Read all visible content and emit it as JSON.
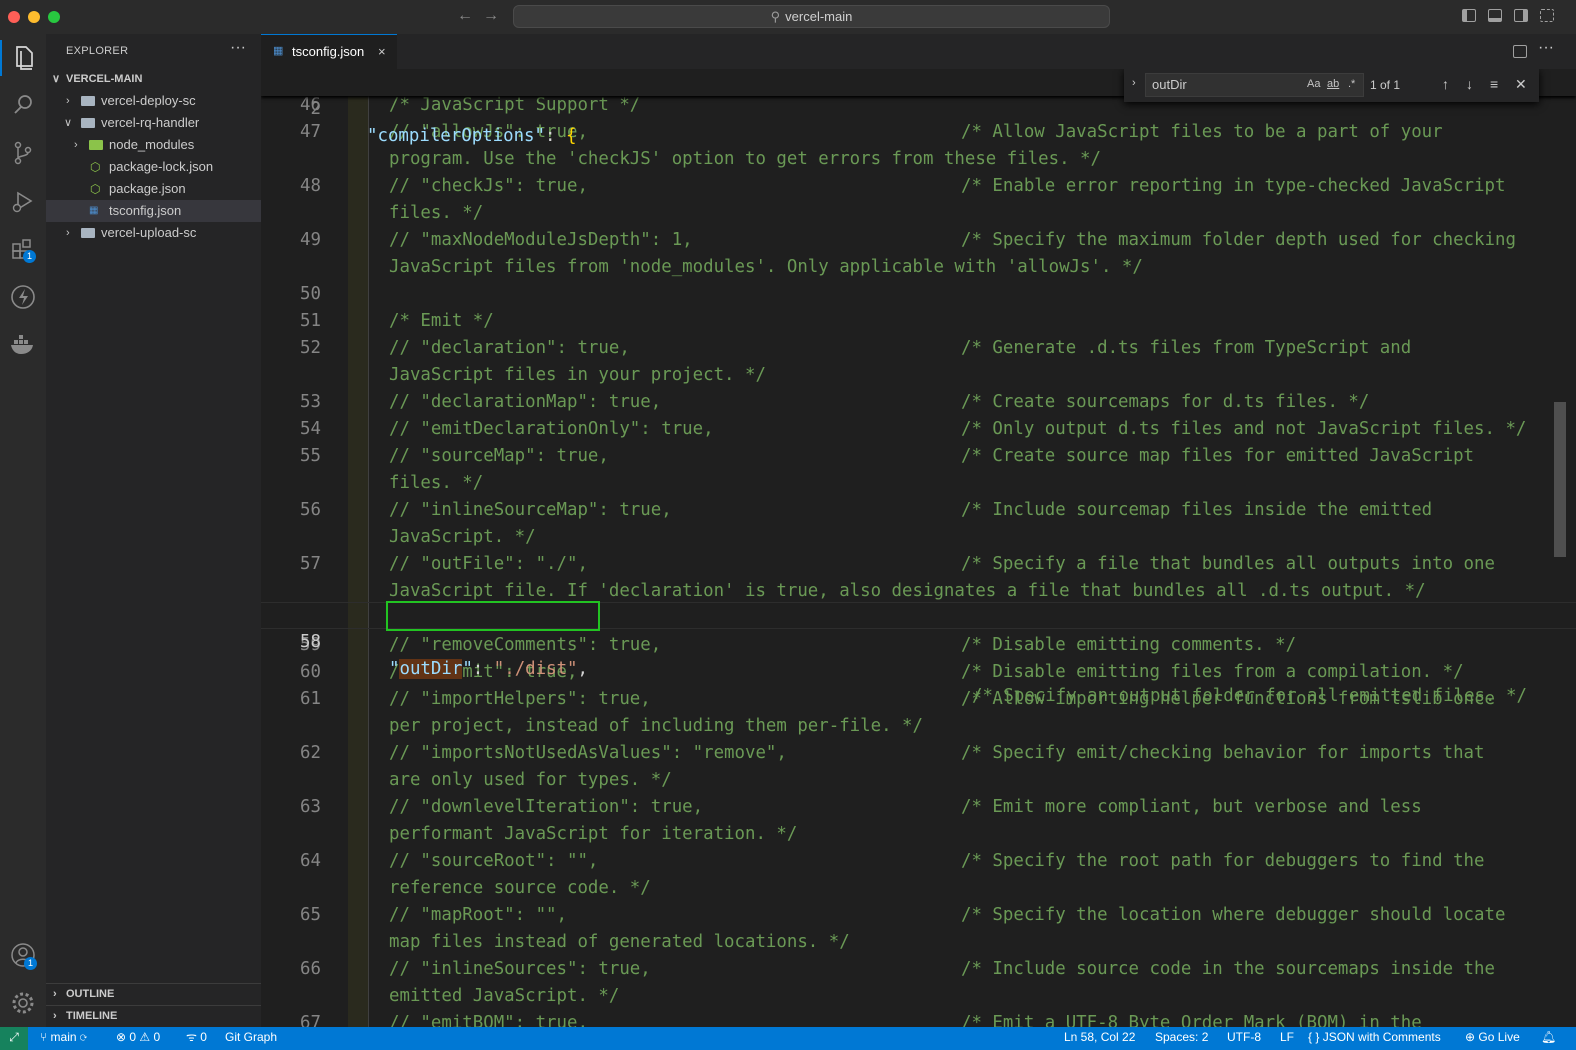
{
  "window": {
    "title": "vercel-main"
  },
  "explorer": {
    "title": "EXPLORER",
    "more": "···",
    "repo": "VERCEL-MAIN",
    "items": [
      {
        "label": "vercel-deploy-sc"
      },
      {
        "label": "vercel-rq-handler"
      },
      {
        "label": "node_modules"
      },
      {
        "label": "package-lock.json"
      },
      {
        "label": "package.json"
      },
      {
        "label": "tsconfig.json"
      },
      {
        "label": "vercel-upload-sc"
      }
    ],
    "outline": "OUTLINE",
    "timeline": "TIMELINE"
  },
  "activity": {
    "extensions_badge": "1",
    "accounts_badge": "1"
  },
  "tab": {
    "label": "tsconfig.json",
    "close": "×"
  },
  "find": {
    "value": "outDir",
    "count": "1 of 1",
    "opt_case": "Aa",
    "opt_word": "ab",
    "opt_regex": ".*"
  },
  "editor": {
    "sticky": {
      "num": "2",
      "key": "\"compilerOptions\"",
      "colon": ": ",
      "brace": "{"
    },
    "rows": [
      {
        "num": "46",
        "code": "/* JavaScript Support */",
        "comment": ""
      },
      {
        "num": "47",
        "code": "// \"allowJs\": true,",
        "comment": "/* Allow JavaScript files to be a part of your"
      },
      {
        "num": "",
        "code": "program. Use the 'checkJS' option to get errors from these files. */",
        "comment": ""
      },
      {
        "num": "48",
        "code": "// \"checkJs\": true,",
        "comment": "/* Enable error reporting in type-checked JavaScript"
      },
      {
        "num": "",
        "code": "files. */",
        "comment": ""
      },
      {
        "num": "49",
        "code": "// \"maxNodeModuleJsDepth\": 1,",
        "comment": "/* Specify the maximum folder depth used for checking"
      },
      {
        "num": "",
        "code": "JavaScript files from 'node_modules'. Only applicable with 'allowJs'. */",
        "comment": ""
      },
      {
        "num": "50",
        "code": "",
        "comment": ""
      },
      {
        "num": "51",
        "code": "/* Emit */",
        "comment": ""
      },
      {
        "num": "52",
        "code": "// \"declaration\": true,",
        "comment": "/* Generate .d.ts files from TypeScript and"
      },
      {
        "num": "",
        "code": "JavaScript files in your project. */",
        "comment": ""
      },
      {
        "num": "53",
        "code": "// \"declarationMap\": true,",
        "comment": "/* Create sourcemaps for d.ts files. */"
      },
      {
        "num": "54",
        "code": "// \"emitDeclarationOnly\": true,",
        "comment": "/* Only output d.ts files and not JavaScript files. */"
      },
      {
        "num": "55",
        "code": "// \"sourceMap\": true,",
        "comment": "/* Create source map files for emitted JavaScript"
      },
      {
        "num": "",
        "code": "files. */",
        "comment": ""
      },
      {
        "num": "56",
        "code": "// \"inlineSourceMap\": true,",
        "comment": "/* Include sourcemap files inside the emitted"
      },
      {
        "num": "",
        "code": "JavaScript. */",
        "comment": ""
      },
      {
        "num": "57",
        "code": "// \"outFile\": \"./\",",
        "comment": "/* Specify a file that bundles all outputs into one"
      },
      {
        "num": "",
        "code": "JavaScript file. If 'declaration' is true, also designates a file that bundles all .d.ts output. */",
        "comment": ""
      },
      {
        "num": "58",
        "code": "",
        "comment": ""
      },
      {
        "num": "59",
        "code": "// \"removeComments\": true,",
        "comment": "/* Disable emitting comments. */"
      },
      {
        "num": "60",
        "code": "// \"noEmit\": true,",
        "comment": "/* Disable emitting files from a compilation. */"
      },
      {
        "num": "61",
        "code": "// \"importHelpers\": true,",
        "comment": "/* Allow importing helper functions from tslib once"
      },
      {
        "num": "",
        "code": "per project, instead of including them per-file. */",
        "comment": ""
      },
      {
        "num": "62",
        "code": "// \"importsNotUsedAsValues\": \"remove\",",
        "comment": "/* Specify emit/checking behavior for imports that"
      },
      {
        "num": "",
        "code": "are only used for types. */",
        "comment": ""
      },
      {
        "num": "63",
        "code": "// \"downlevelIteration\": true,",
        "comment": "/* Emit more compliant, but verbose and less"
      },
      {
        "num": "",
        "code": "performant JavaScript for iteration. */",
        "comment": ""
      },
      {
        "num": "64",
        "code": "// \"sourceRoot\": \"\",",
        "comment": "/* Specify the root path for debuggers to find the"
      },
      {
        "num": "",
        "code": "reference source code. */",
        "comment": ""
      },
      {
        "num": "65",
        "code": "// \"mapRoot\": \"\",",
        "comment": "/* Specify the location where debugger should locate"
      },
      {
        "num": "",
        "code": "map files instead of generated locations. */",
        "comment": ""
      },
      {
        "num": "66",
        "code": "// \"inlineSources\": true,",
        "comment": "/* Include source code in the sourcemaps inside the"
      },
      {
        "num": "",
        "code": "emitted JavaScript. */",
        "comment": ""
      },
      {
        "num": "67",
        "code": "// \"emitBOM\": true,",
        "comment": "/* Emit a UTF-8 Byte Order Mark (BOM) in the"
      }
    ],
    "active": {
      "q1": "\"",
      "key": "outDir",
      "q2": "\"",
      "colon": ": ",
      "value": "\"./dist\"",
      "comma": ",",
      "comment": "/* Specify an output folder for all emitted files. */"
    }
  },
  "status": {
    "branch": "main",
    "errors": "0",
    "warnings": "0",
    "ports": "0",
    "git_graph": "Git Graph",
    "position": "Ln 58, Col 22",
    "spaces": "Spaces: 2",
    "encoding": "UTF-8",
    "eol": "LF",
    "language": "JSON with Comments",
    "golive": "Go Live"
  },
  "colors": {
    "accent": "#0078d4",
    "find_highlight": "#623315",
    "box": "#22c322",
    "comment": "#6a9955"
  }
}
